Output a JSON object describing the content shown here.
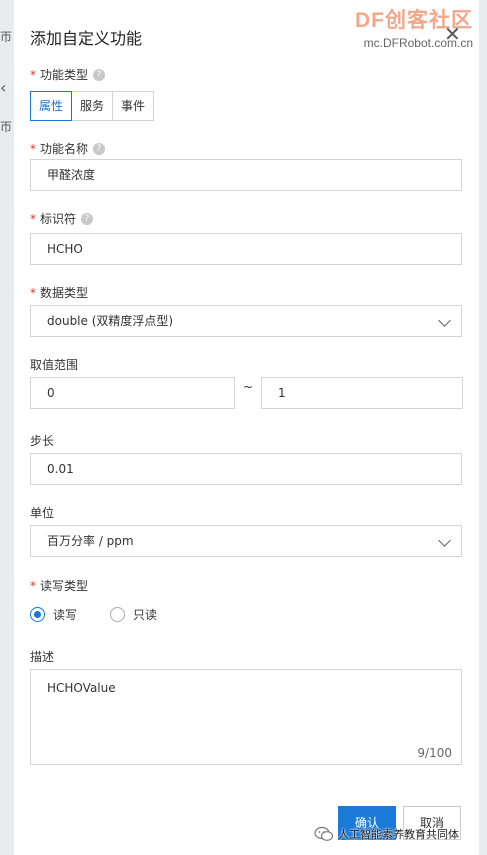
{
  "dialog": {
    "title": "添加自定义功能",
    "watermark_brand": "DF创客社区",
    "watermark_url": "mc.DFRobot.com.cn"
  },
  "feature_type": {
    "label": "功能类型",
    "options": [
      "属性",
      "服务",
      "事件"
    ],
    "selected": "属性"
  },
  "feature_name": {
    "label": "功能名称",
    "value": "甲醛浓度"
  },
  "identifier": {
    "label": "标识符",
    "value": "HCHO"
  },
  "data_type": {
    "label": "数据类型",
    "value": "double (双精度浮点型)"
  },
  "value_range": {
    "label": "取值范围",
    "min": "0",
    "separator": "~",
    "max": "1"
  },
  "step": {
    "label": "步长",
    "value": "0.01"
  },
  "unit": {
    "label": "单位",
    "value": "百万分率 / ppm"
  },
  "rw_type": {
    "label": "读写类型",
    "options": [
      "读写",
      "只读"
    ],
    "selected": "读写"
  },
  "description": {
    "label": "描述",
    "value": "HCHOValue",
    "counter": "9/100"
  },
  "footer": {
    "confirm": "确认",
    "cancel": "取消"
  },
  "overlay": {
    "wechat_text": "人工智能素养教育共同体"
  },
  "colors": {
    "primary": "#1c7ad9",
    "required": "#e0342b",
    "brand": "#f3a78a"
  }
}
